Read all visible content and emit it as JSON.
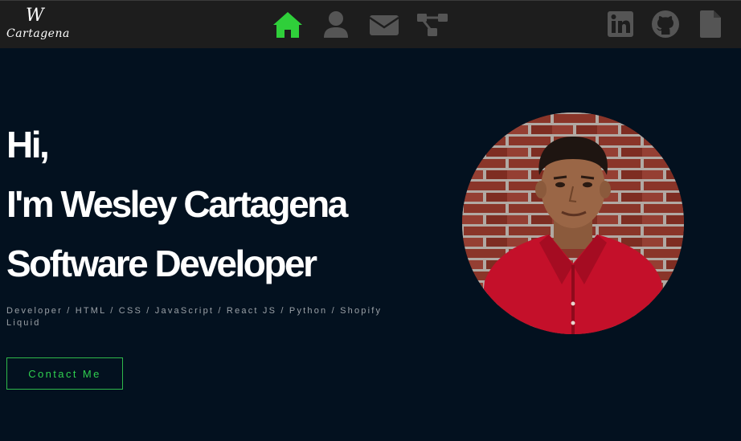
{
  "logo": {
    "mark": "W",
    "name": "Cartagena"
  },
  "nav": {
    "items": [
      {
        "icon": "home-icon",
        "active": true
      },
      {
        "icon": "user-icon",
        "active": false
      },
      {
        "icon": "envelope-icon",
        "active": false
      },
      {
        "icon": "project-diagram-icon",
        "active": false
      }
    ],
    "social": [
      {
        "icon": "linkedin-icon"
      },
      {
        "icon": "github-icon"
      },
      {
        "icon": "resume-file-icon"
      }
    ]
  },
  "hero": {
    "greeting": "Hi,",
    "intro": "I'm Wesley Cartagena",
    "role": "Software Developer",
    "skills": "Developer / HTML / CSS / JavaScript / React JS / Python / Shopify Liquid",
    "contact_label": "Contact Me"
  },
  "colors": {
    "background": "#03111f",
    "navbar": "#1d1d1d",
    "accent_green": "#2fcf4f",
    "icon_gray": "#555555"
  }
}
